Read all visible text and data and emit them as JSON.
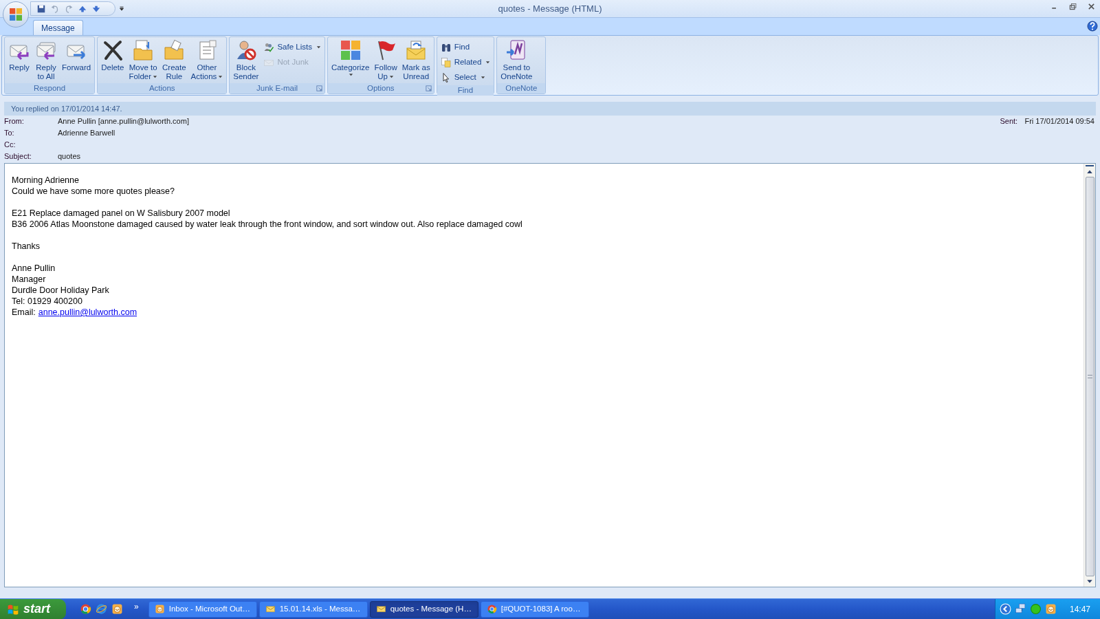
{
  "window": {
    "title": "quotes - Message (HTML)"
  },
  "tabs": [
    {
      "label": "Message",
      "selected": true
    }
  ],
  "ribbon": [
    {
      "name": "Respond",
      "launcher": false,
      "items": [
        {
          "kind": "large",
          "lines": [
            "Reply"
          ],
          "dropdown": false,
          "disabled": false
        },
        {
          "kind": "large",
          "lines": [
            "Reply",
            "to All"
          ],
          "dropdown": false,
          "disabled": false
        },
        {
          "kind": "large",
          "lines": [
            "Forward"
          ],
          "dropdown": false,
          "disabled": false
        }
      ]
    },
    {
      "name": "Actions",
      "launcher": false,
      "items": [
        {
          "kind": "large",
          "lines": [
            "Delete"
          ],
          "dropdown": false,
          "disabled": false
        },
        {
          "kind": "large",
          "lines": [
            "Move to",
            "Folder"
          ],
          "dropdown": true,
          "disabled": false
        },
        {
          "kind": "large",
          "lines": [
            "Create",
            "Rule"
          ],
          "dropdown": false,
          "disabled": false
        },
        {
          "kind": "large",
          "lines": [
            "Other",
            "Actions"
          ],
          "dropdown": true,
          "disabled": false
        }
      ]
    },
    {
      "name": "Junk E-mail",
      "launcher": true,
      "items": [
        {
          "kind": "large",
          "lines": [
            "Block",
            "Sender"
          ],
          "dropdown": false,
          "disabled": false
        },
        {
          "kind": "small",
          "lines": [
            "Safe Lists"
          ],
          "dropdown": true,
          "disabled": false
        },
        {
          "kind": "small",
          "lines": [
            "Not Junk"
          ],
          "dropdown": false,
          "disabled": true
        }
      ]
    },
    {
      "name": "Options",
      "launcher": true,
      "items": [
        {
          "kind": "large",
          "lines": [
            "Categorize"
          ],
          "dropdown": true,
          "disabled": false
        },
        {
          "kind": "large",
          "lines": [
            "Follow",
            "Up"
          ],
          "dropdown": true,
          "disabled": false
        },
        {
          "kind": "large",
          "lines": [
            "Mark as",
            "Unread"
          ],
          "dropdown": false,
          "disabled": false
        }
      ]
    },
    {
      "name": "Find",
      "launcher": false,
      "items": [
        {
          "kind": "small",
          "lines": [
            "Find"
          ],
          "dropdown": false,
          "disabled": false
        },
        {
          "kind": "small",
          "lines": [
            "Related"
          ],
          "dropdown": true,
          "disabled": false
        },
        {
          "kind": "small",
          "lines": [
            "Select"
          ],
          "dropdown": true,
          "disabled": false
        }
      ]
    },
    {
      "name": "OneNote",
      "launcher": false,
      "items": [
        {
          "kind": "large",
          "lines": [
            "Send to",
            "OneNote"
          ],
          "dropdown": false,
          "disabled": false
        }
      ]
    }
  ],
  "info_bar": "You replied on 17/01/2014 14:47.",
  "header": {
    "from_label": "From:",
    "from": "Anne Pullin [anne.pullin@lulworth.com]",
    "sent_label": "Sent:",
    "sent": "Fri 17/01/2014 09:54",
    "to_label": "To:",
    "to": "Adrienne Barwell",
    "cc_label": "Cc:",
    "subject_label": "Subject:",
    "subject": "quotes"
  },
  "body": [
    [
      "Morning Adrienne",
      "Could we have some more quotes please?"
    ],
    [
      "E21 Replace damaged panel on W Salisbury 2007 model",
      "B36 2006 Atlas Moonstone damaged caused by water leak through the front window, and sort window out. Also replace damaged cowl"
    ],
    [
      "Thanks"
    ],
    [
      "Anne Pullin",
      "Manager",
      "Durdle Door Holiday Park",
      "Tel: 01929 400200"
    ]
  ],
  "email_line": {
    "label": "Email:",
    "link": "anne.pullin@lulworth.com"
  },
  "taskbar": {
    "start": "start",
    "quick_launch_more": "»",
    "tasks": [
      {
        "label": "Inbox - Microsoft Out…",
        "selected": false
      },
      {
        "label": "15.01.14.xls - Messa…",
        "selected": false
      },
      {
        "label": "quotes - Message (H…",
        "selected": true
      },
      {
        "label": "[#QUOT-1083] A roo…",
        "selected": false
      }
    ],
    "clock": "14:47"
  }
}
